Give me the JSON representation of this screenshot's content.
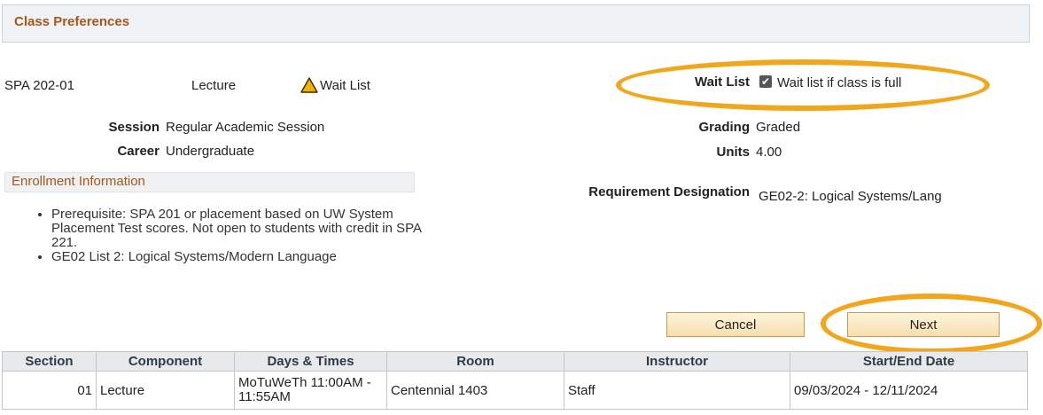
{
  "header": {
    "title": "Class Preferences"
  },
  "class_info": {
    "section": "SPA  202-01",
    "component": "Lecture",
    "status": "Wait List",
    "session_label": "Session",
    "session_value": "Regular Academic Session",
    "career_label": "Career",
    "career_value": "Undergraduate"
  },
  "preferences": {
    "waitlist_label": "Wait List",
    "waitlist_checkbox_text": "Wait list if class is full",
    "waitlist_checked": true,
    "grading_label": "Grading",
    "grading_value": "Graded",
    "units_label": "Units",
    "units_value": "4.00",
    "requirement_label": "Requirement Designation",
    "requirement_value": "GE02-2: Logical Systems/Lang"
  },
  "enrollment": {
    "heading": "Enrollment Information",
    "items": [
      "Prerequisite: SPA 201 or placement based on UW System Placement Test scores. Not open to students with credit in SPA 221.",
      "GE02 List 2: Logical Systems/Modern Language"
    ]
  },
  "buttons": {
    "cancel": "Cancel",
    "next": "Next"
  },
  "table": {
    "headers": [
      "Section",
      "Component",
      "Days & Times",
      "Room",
      "Instructor",
      "Start/End Date"
    ],
    "rows": [
      [
        "01",
        "Lecture",
        "MoTuWeTh 11:00AM - 11:55AM",
        "Centennial 1403",
        "Staff",
        "09/03/2024 - 12/11/2024"
      ]
    ]
  },
  "icons": {
    "status_icon": "warning-triangle-icon",
    "checkbox_icon": "checkmark-icon"
  },
  "colors": {
    "accent_title": "#a8561c",
    "highlight": "#f2a61c",
    "warning": "#f2b300"
  }
}
